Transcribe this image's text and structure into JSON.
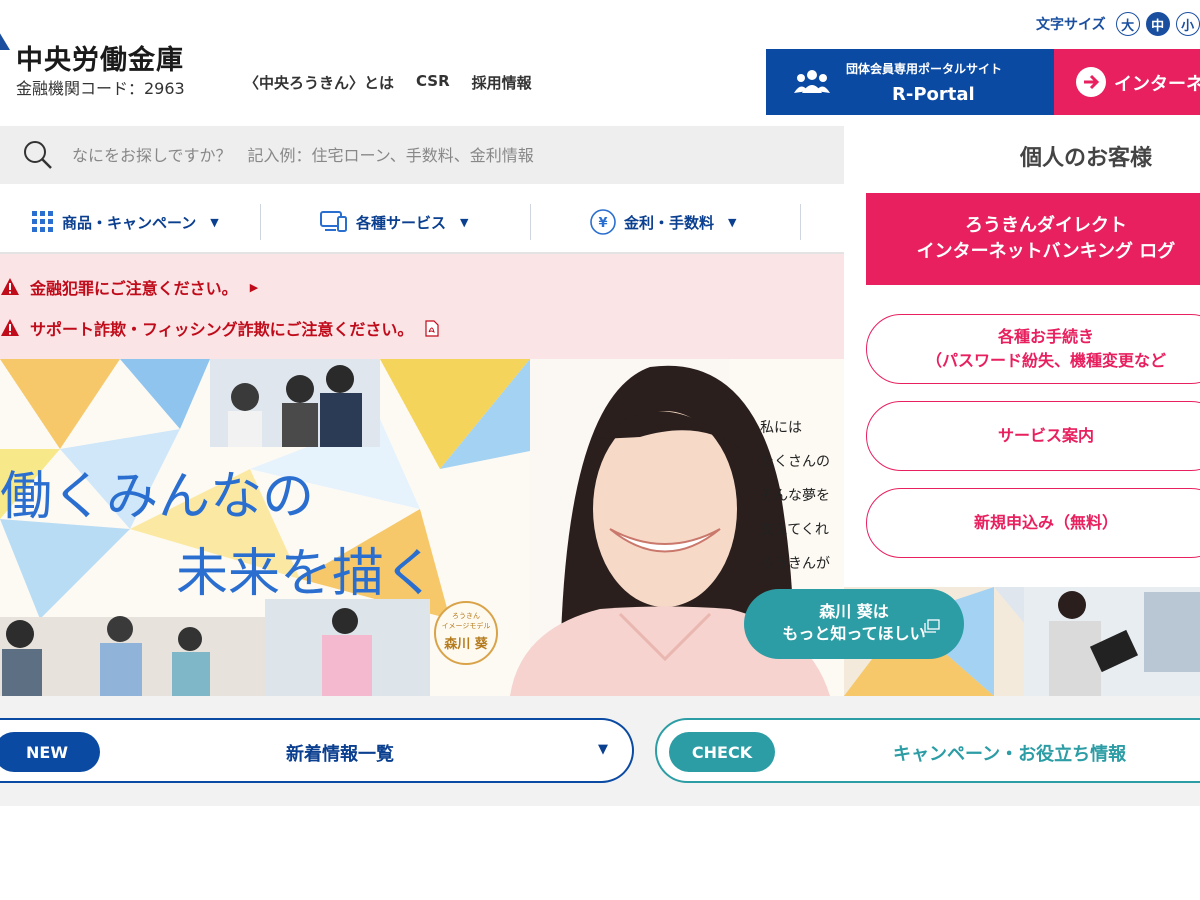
{
  "header": {
    "bank_name": "中央労働金庫",
    "bank_code": "金融機関コード：2963",
    "nav": [
      "〈中央ろうきん〉とは",
      "CSR",
      "採用情報"
    ],
    "font_size_label": "文字サイズ",
    "font_sizes": [
      "大",
      "中",
      "小"
    ],
    "font_size_selected": "中",
    "portal": {
      "sub": "団体会員専用ポータルサイト",
      "main": "R-Portal"
    },
    "internet_button": "インターネ"
  },
  "search": {
    "placeholder": "なにをお探しですか？　記入例：住宅ローン、手数料、金利情報"
  },
  "categories": [
    {
      "label": "商品・キャンペーン",
      "icon": "grid-icon"
    },
    {
      "label": "各種サービス",
      "icon": "computer-icon"
    },
    {
      "label": "金利・手数料",
      "icon": "yen-icon"
    }
  ],
  "alerts": [
    {
      "text": "金融犯罪にご注意ください。",
      "suffix": "arrow"
    },
    {
      "text": "サポート詐欺・フィッシング詐欺にご注意ください。",
      "suffix": "pdf"
    }
  ],
  "hero": {
    "tagline_line1": "働くみんなの",
    "tagline_line2": "未来を描く",
    "handwritten": [
      "私には",
      "たくさんの",
      "そんな夢を",
      "支えてくれ",
      "ろうきんが"
    ],
    "seal": {
      "line1": "ろうきん",
      "line2": "イメージモデル",
      "name": "森川 葵"
    },
    "more_button": {
      "line1": "森川 葵は",
      "line2": "もっと知ってほしい"
    }
  },
  "panel": {
    "title": "個人のお客様",
    "direct_login": {
      "line1": "ろうきんダイレクト",
      "line2": "インターネットバンキング ログ"
    },
    "procedures": {
      "line1": "各種お手続き",
      "line2": "（パスワード紛失、機種変更など"
    },
    "services": "サービス案内",
    "new_application": "新規申込み（無料）"
  },
  "news": {
    "badge": "NEW",
    "label": "新着情報一覧"
  },
  "check": {
    "badge": "CHECK",
    "label": "キャンペーン・お役立ち情報"
  },
  "colors": {
    "primary_blue": "#0b4aa2",
    "accent_pink": "#e8205f",
    "teal": "#2c9da5",
    "alert_red": "#c00b1a",
    "alert_bg": "#fae4e6"
  }
}
